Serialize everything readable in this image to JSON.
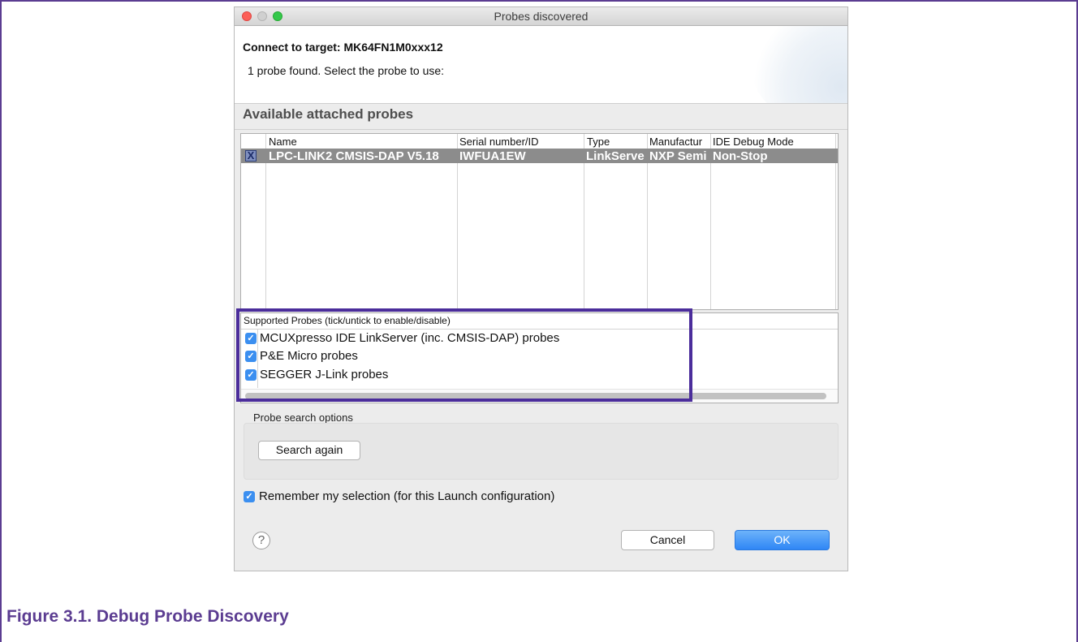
{
  "window": {
    "title": "Probes discovered"
  },
  "header": {
    "connect_title": "Connect to target: MK64FN1M0xxx12",
    "probe_found": "1 probe found. Select the probe to use:"
  },
  "probes_section": {
    "title": "Available attached probes",
    "columns": [
      "Name",
      "Serial number/ID",
      "Type",
      "Manufactur",
      "IDE Debug Mode"
    ],
    "rows": [
      {
        "checked": true,
        "name": "LPC-LINK2 CMSIS-DAP V5.18",
        "serial": "IWFUA1EW",
        "type": "LinkServe",
        "manufacturer": "NXP Semi",
        "mode": "Non-Stop"
      }
    ]
  },
  "supported_probes": {
    "header": "Supported Probes (tick/untick to enable/disable)",
    "items": [
      {
        "label": "MCUXpresso IDE LinkServer (inc. CMSIS-DAP) probes",
        "checked": true
      },
      {
        "label": "P&E Micro probes",
        "checked": true
      },
      {
        "label": "SEGGER J-Link probes",
        "checked": true
      }
    ]
  },
  "search_options": {
    "label": "Probe search options",
    "search_again": "Search again"
  },
  "remember": {
    "label": "Remember my selection (for this Launch configuration)",
    "checked": true
  },
  "footer": {
    "help_glyph": "?",
    "cancel": "Cancel",
    "ok": "OK"
  },
  "caption": "Figure 3.1. Debug Probe Discovery",
  "colors": {
    "accent_purple": "#4b2d9b",
    "ok_blue": "#2f86f5",
    "checkbox_blue": "#3b8ff0",
    "selected_row": "#8c8c8c"
  }
}
